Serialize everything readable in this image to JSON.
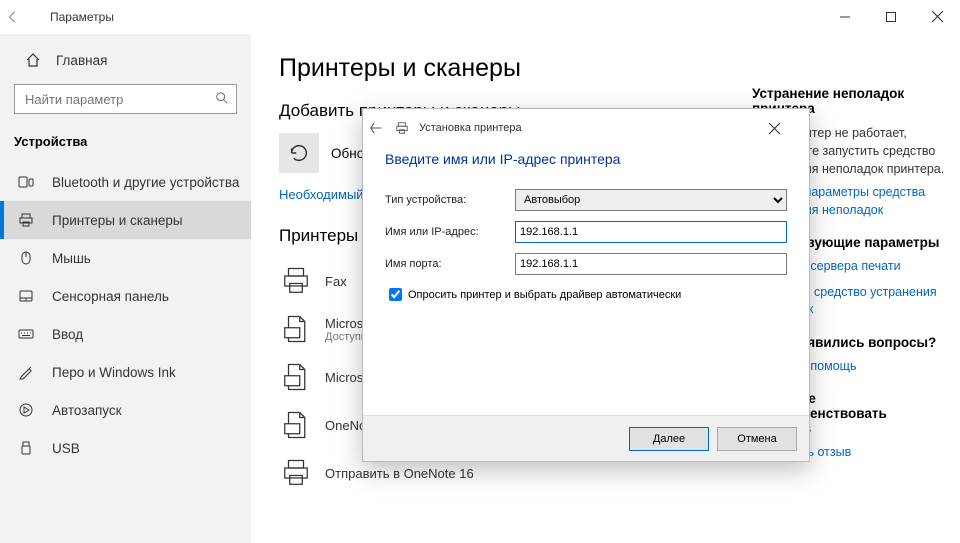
{
  "titlebar": {
    "title": "Параметры"
  },
  "sidebar": {
    "home": "Главная",
    "search_placeholder": "Найти параметр",
    "header": "Устройства",
    "items": [
      {
        "label": "Bluetooth и другие устройства"
      },
      {
        "label": "Принтеры и сканеры"
      },
      {
        "label": "Мышь"
      },
      {
        "label": "Сенсорная панель"
      },
      {
        "label": "Ввод"
      },
      {
        "label": "Перо и Windows Ink"
      },
      {
        "label": "Автозапуск"
      },
      {
        "label": "USB"
      }
    ]
  },
  "content": {
    "h1": "Принтеры и сканеры",
    "add_h": "Добавить принтеры и сканеры",
    "refresh_text": "Обновить",
    "required_link": "Необходимый принтер отсутствует в списке",
    "list_h": "Принтеры и сканеры",
    "printers": [
      {
        "name": "Fax",
        "sub": ""
      },
      {
        "name": "Microsoft Print to PDF",
        "sub": "Доступно"
      },
      {
        "name": "Microsoft XPS Document Writer",
        "sub": ""
      },
      {
        "name": "OneNote",
        "sub": ""
      },
      {
        "name": "Отправить в OneNote 16",
        "sub": ""
      }
    ]
  },
  "right": {
    "trouble_h": "Устранение неполадок принтера",
    "trouble_text": "Если принтер не работает, попробуйте запустить средство устранения неполадок принтера.",
    "trouble_link": "Открыть параметры средства устранения неполадок",
    "related_h": "Сопутствующие параметры",
    "related_link1": "Свойства сервера печати",
    "related_link2": "Запустить средство устранения неполадок",
    "question_h": "У вас появились вопросы?",
    "question_link": "Получить помощь",
    "improve_h": "Помогите усовершенствовать Windows",
    "improve_link": "Отправить отзыв"
  },
  "dialog": {
    "title": "Установка принтера",
    "heading": "Введите имя или IP-адрес принтера",
    "label_type": "Тип устройства:",
    "type_value": "Автовыбор",
    "label_name": "Имя или IP-адрес:",
    "name_value": "192.168.1.1",
    "label_port": "Имя порта:",
    "port_value": "192.168.1.1",
    "check": "Опросить принтер и выбрать драйвер автоматически",
    "btn_next": "Далее",
    "btn_cancel": "Отмена"
  }
}
